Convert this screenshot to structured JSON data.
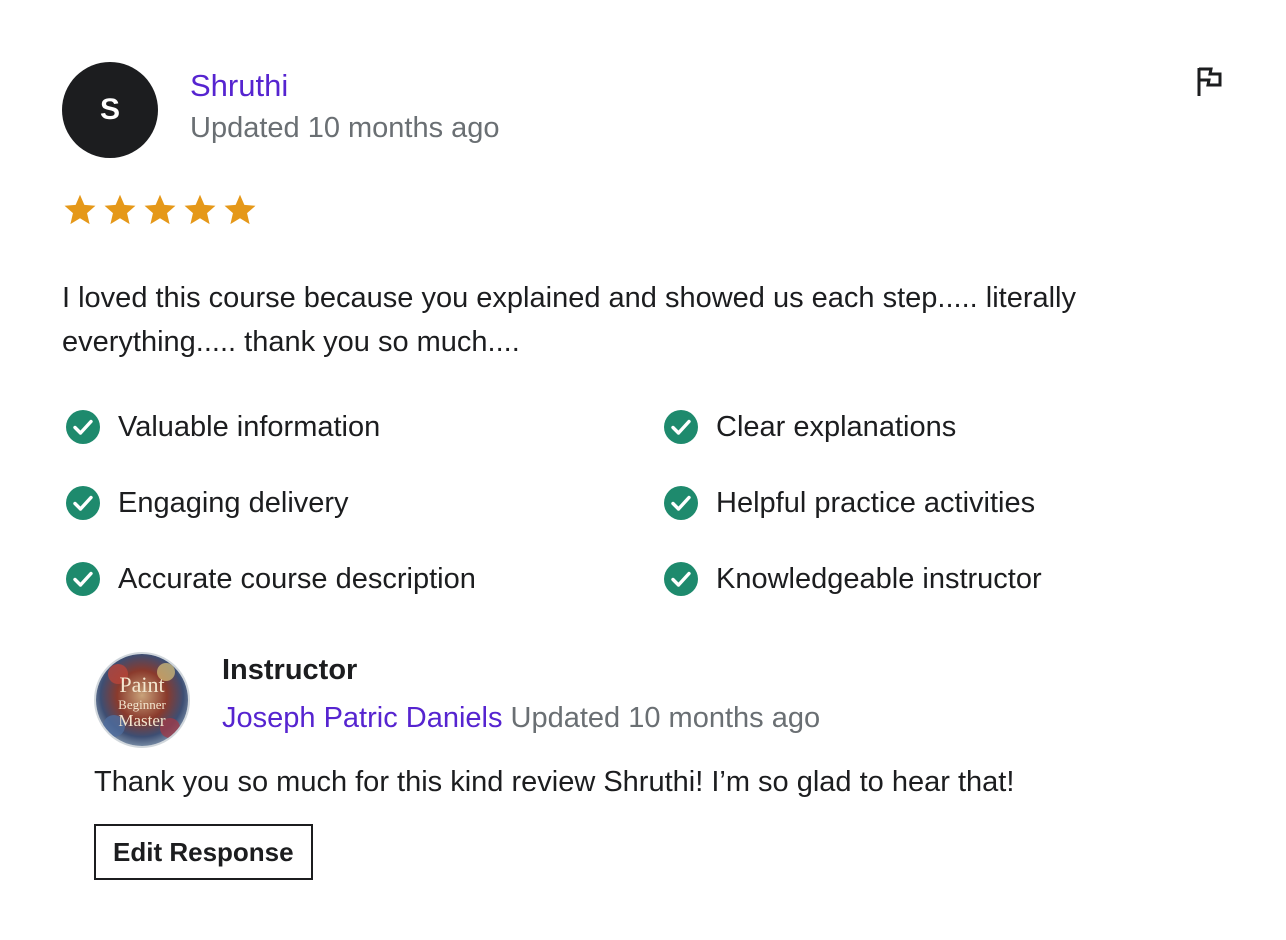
{
  "review": {
    "avatar_initial": "S",
    "reviewer_name": "Shruthi",
    "updated": "Updated 10 months ago",
    "rating": 5,
    "text": "I loved this course because you explained and showed us each step..... literally everything..... thank you so much....",
    "attributes": [
      {
        "label": "Valuable information"
      },
      {
        "label": "Clear explanations"
      },
      {
        "label": "Engaging delivery"
      },
      {
        "label": "Helpful practice activities"
      },
      {
        "label": "Accurate course description"
      },
      {
        "label": "Knowledgeable instructor"
      }
    ]
  },
  "response": {
    "role": "Instructor",
    "instructor_name": "Joseph Patric Daniels",
    "updated": "Updated 10 months ago",
    "text": "Thank you so much for this kind review Shruthi! I’m so glad to hear that!",
    "edit_label": "Edit Response",
    "avatar_logo_lines": [
      "Paint",
      "Beginner",
      "Master"
    ]
  },
  "colors": {
    "accent": "#5624d0",
    "star": "#e59819",
    "check": "#1e8a6d",
    "muted_text": "#6a6f73",
    "text": "#1c1d1f"
  },
  "icons": {
    "flag": "flag-icon",
    "star": "star-icon",
    "check": "check-circle-icon"
  }
}
